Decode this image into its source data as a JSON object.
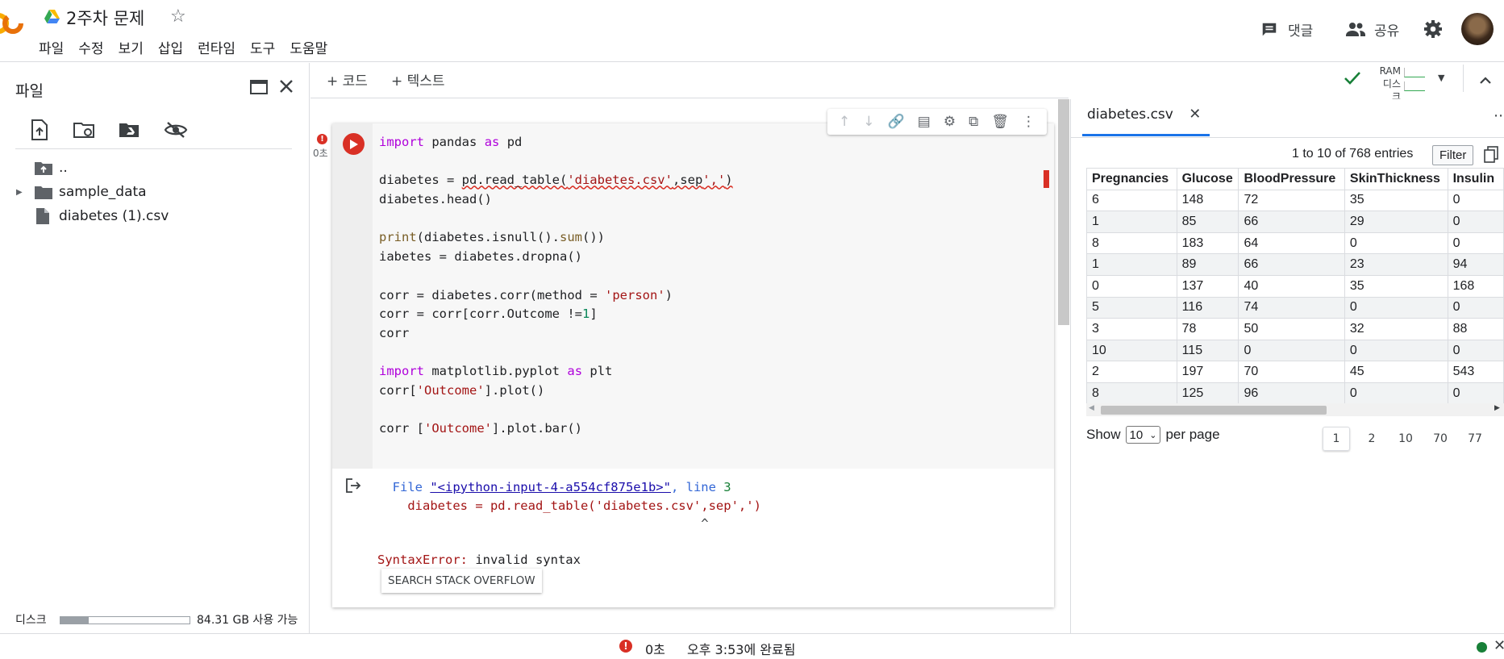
{
  "app": {
    "title": "2주차 문제",
    "menu": [
      "파일",
      "수정",
      "보기",
      "삽입",
      "런타임",
      "도구",
      "도움말"
    ],
    "comment_label": "댓글",
    "share_label": "공유"
  },
  "left_panel": {
    "title": "파일",
    "tree": [
      {
        "label": "..",
        "icon": "folder-up-icon"
      },
      {
        "label": "sample_data",
        "icon": "folder-icon"
      },
      {
        "label": "diabetes (1).csv",
        "icon": "file-icon"
      }
    ],
    "disk_label": "디스크",
    "disk_free": "84.31 GB 사용 가능",
    "disk_used_fraction": 0.22
  },
  "toolbar": {
    "add_code": "+ 코드",
    "add_text": "+ 텍스트",
    "ram_label": "RAM",
    "disk_label": "디스크"
  },
  "cell": {
    "exec_time": "0초",
    "code_lines": [
      "import pandas as pd",
      "",
      "diabetes = pd.read_table('diabetes.csv',sep',')",
      "diabetes.head()",
      "",
      "print(diabetes.isnull().sum())",
      "iabetes = diabetes.dropna()",
      "",
      "corr = diabetes.corr(method = 'person')",
      "corr = corr[corr.Outcome !=1]",
      "corr",
      "",
      "import matplotlib.pyplot as plt",
      "corr['Outcome'].plot()",
      "",
      "corr ['Outcome'].plot.bar()"
    ],
    "output": {
      "file_prefix": "  File ",
      "file_link": "\"<ipython-input-4-a554cf875e1b>\"",
      "line_sep": ", line ",
      "line_num": "3",
      "error_line": "    diabetes = pd.read_table('diabetes.csv',sep',')",
      "caret": "                                           ^",
      "error_type": "SyntaxError:",
      "error_msg": " invalid syntax",
      "so_button": "SEARCH STACK OVERFLOW"
    }
  },
  "csv_panel": {
    "tab_label": "diabetes.csv",
    "entries_text": "1 to 10 of 768 entries",
    "filter_label": "Filter",
    "columns": [
      "Pregnancies",
      "Glucose",
      "BloodPressure",
      "SkinThickness",
      "Insulin"
    ],
    "rows": [
      [
        "6",
        "148",
        "72",
        "35",
        "0"
      ],
      [
        "1",
        "85",
        "66",
        "29",
        "0"
      ],
      [
        "8",
        "183",
        "64",
        "0",
        "0"
      ],
      [
        "1",
        "89",
        "66",
        "23",
        "94"
      ],
      [
        "0",
        "137",
        "40",
        "35",
        "168"
      ],
      [
        "5",
        "116",
        "74",
        "0",
        "0"
      ],
      [
        "3",
        "78",
        "50",
        "32",
        "88"
      ],
      [
        "10",
        "115",
        "0",
        "0",
        "0"
      ],
      [
        "2",
        "197",
        "70",
        "45",
        "543"
      ],
      [
        "8",
        "125",
        "96",
        "0",
        "0"
      ]
    ],
    "show_label": "Show",
    "per_page_value": "10",
    "per_page_label": "per page",
    "pages": [
      "1",
      "2",
      "10",
      "70",
      "77"
    ]
  },
  "status_bar": {
    "exec_time": "0초",
    "completed_text": "오후 3:53에 완료됨"
  },
  "colors": {
    "error_red": "#d93025",
    "link_blue": "#1a0dab",
    "keyword_purple": "#af00db",
    "string_red": "#a31515",
    "ok_green": "#188038"
  }
}
